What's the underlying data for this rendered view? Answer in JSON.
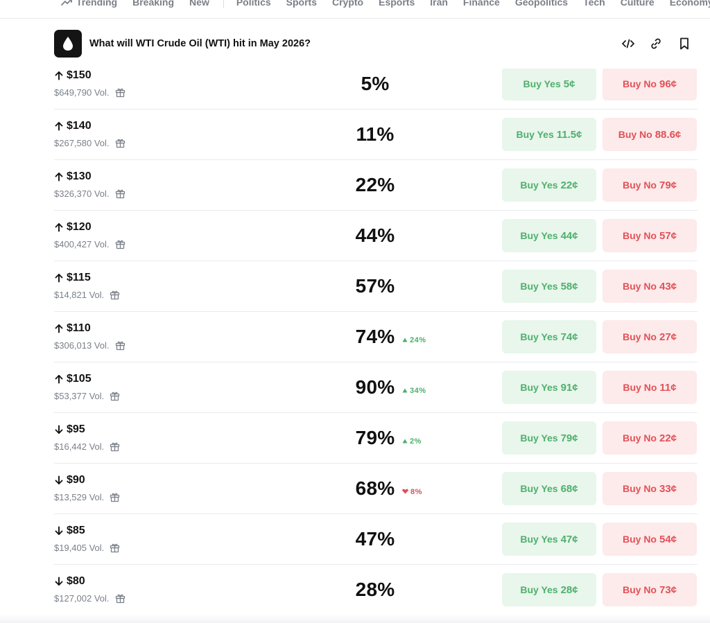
{
  "nav": {
    "items": [
      {
        "label": "Trending",
        "icon": "trending-icon"
      },
      {
        "label": "Breaking"
      },
      {
        "label": "New"
      },
      {
        "label": "Politics"
      },
      {
        "label": "Sports"
      },
      {
        "label": "Crypto"
      },
      {
        "label": "Esports"
      },
      {
        "label": "Iran"
      },
      {
        "label": "Finance"
      },
      {
        "label": "Geopolitics"
      },
      {
        "label": "Tech"
      },
      {
        "label": "Culture"
      },
      {
        "label": "Economy"
      }
    ]
  },
  "market": {
    "title": "What will WTI Crude Oil (WTI) hit in May 2026?",
    "logo_icon": "oil-drop-icon",
    "actions": [
      "embed-icon",
      "link-icon",
      "bookmark-icon"
    ]
  },
  "colors": {
    "yes_bg": "#e8f6ec",
    "yes_text": "#4faf6c",
    "no_bg": "#fdeaea",
    "no_text": "#e05158",
    "delta_up": "#4caf6b",
    "delta_down": "#df4e55"
  },
  "outcomes": [
    {
      "direction": "up",
      "label": "$150",
      "volume": "$649,790 Vol.",
      "chance": "5%",
      "delta": "",
      "delta_dir": "",
      "yes_label": "Buy Yes",
      "yes_price": "5¢",
      "no_label": "Buy No",
      "no_price": "96¢"
    },
    {
      "direction": "up",
      "label": "$140",
      "volume": "$267,580 Vol.",
      "chance": "11%",
      "delta": "",
      "delta_dir": "",
      "yes_label": "Buy Yes",
      "yes_price": "11.5¢",
      "no_label": "Buy No",
      "no_price": "88.6¢"
    },
    {
      "direction": "up",
      "label": "$130",
      "volume": "$326,370 Vol.",
      "chance": "22%",
      "delta": "",
      "delta_dir": "",
      "yes_label": "Buy Yes",
      "yes_price": "22¢",
      "no_label": "Buy No",
      "no_price": "79¢"
    },
    {
      "direction": "up",
      "label": "$120",
      "volume": "$400,427 Vol.",
      "chance": "44%",
      "delta": "",
      "delta_dir": "",
      "yes_label": "Buy Yes",
      "yes_price": "44¢",
      "no_label": "Buy No",
      "no_price": "57¢"
    },
    {
      "direction": "up",
      "label": "$115",
      "volume": "$14,821 Vol.",
      "chance": "57%",
      "delta": "",
      "delta_dir": "",
      "yes_label": "Buy Yes",
      "yes_price": "58¢",
      "no_label": "Buy No",
      "no_price": "43¢"
    },
    {
      "direction": "up",
      "label": "$110",
      "volume": "$306,013 Vol.",
      "chance": "74%",
      "delta": "24%",
      "delta_dir": "up",
      "yes_label": "Buy Yes",
      "yes_price": "74¢",
      "no_label": "Buy No",
      "no_price": "27¢"
    },
    {
      "direction": "up",
      "label": "$105",
      "volume": "$53,377 Vol.",
      "chance": "90%",
      "delta": "34%",
      "delta_dir": "up",
      "yes_label": "Buy Yes",
      "yes_price": "91¢",
      "no_label": "Buy No",
      "no_price": "11¢"
    },
    {
      "direction": "down",
      "label": "$95",
      "volume": "$16,442 Vol.",
      "chance": "79%",
      "delta": "2%",
      "delta_dir": "up",
      "yes_label": "Buy Yes",
      "yes_price": "79¢",
      "no_label": "Buy No",
      "no_price": "22¢"
    },
    {
      "direction": "down",
      "label": "$90",
      "volume": "$13,529 Vol.",
      "chance": "68%",
      "delta": "8%",
      "delta_dir": "down",
      "yes_label": "Buy Yes",
      "yes_price": "68¢",
      "no_label": "Buy No",
      "no_price": "33¢"
    },
    {
      "direction": "down",
      "label": "$85",
      "volume": "$19,405 Vol.",
      "chance": "47%",
      "delta": "",
      "delta_dir": "",
      "yes_label": "Buy Yes",
      "yes_price": "47¢",
      "no_label": "Buy No",
      "no_price": "54¢"
    },
    {
      "direction": "down",
      "label": "$80",
      "volume": "$127,002 Vol.",
      "chance": "28%",
      "delta": "",
      "delta_dir": "",
      "yes_label": "Buy Yes",
      "yes_price": "28¢",
      "no_label": "Buy No",
      "no_price": "73¢"
    }
  ]
}
